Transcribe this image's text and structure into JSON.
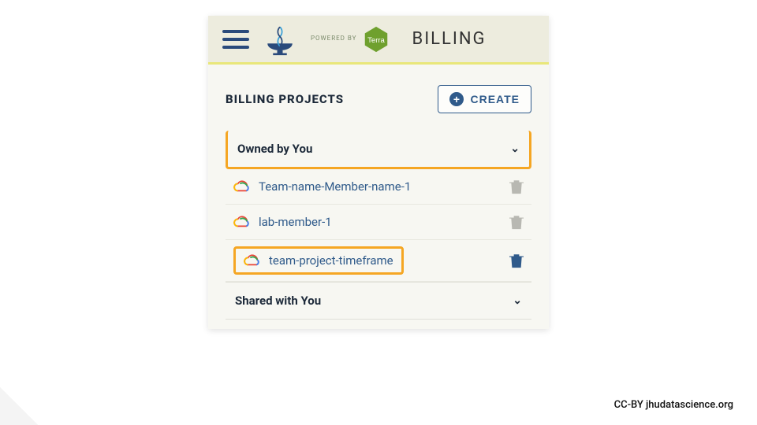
{
  "topbar": {
    "powered_label": "POWERED\nBY",
    "terra_label": "Terra",
    "page_title": "BILLING"
  },
  "content": {
    "heading": "BILLING PROJECTS",
    "create_label": "CREATE"
  },
  "sections": {
    "owned": {
      "label": "Owned by You",
      "expanded": true
    },
    "shared": {
      "label": "Shared with You",
      "expanded": false
    }
  },
  "projects": [
    {
      "name": "Team-name-Member-name-1",
      "delete_active": false,
      "highlighted": false
    },
    {
      "name": "lab-member-1",
      "delete_active": false,
      "highlighted": false
    },
    {
      "name": "team-project-timeframe",
      "delete_active": true,
      "highlighted": true
    }
  ],
  "highlight_color": "#f5a623",
  "footer": "CC-BY  jhudatascience.org"
}
